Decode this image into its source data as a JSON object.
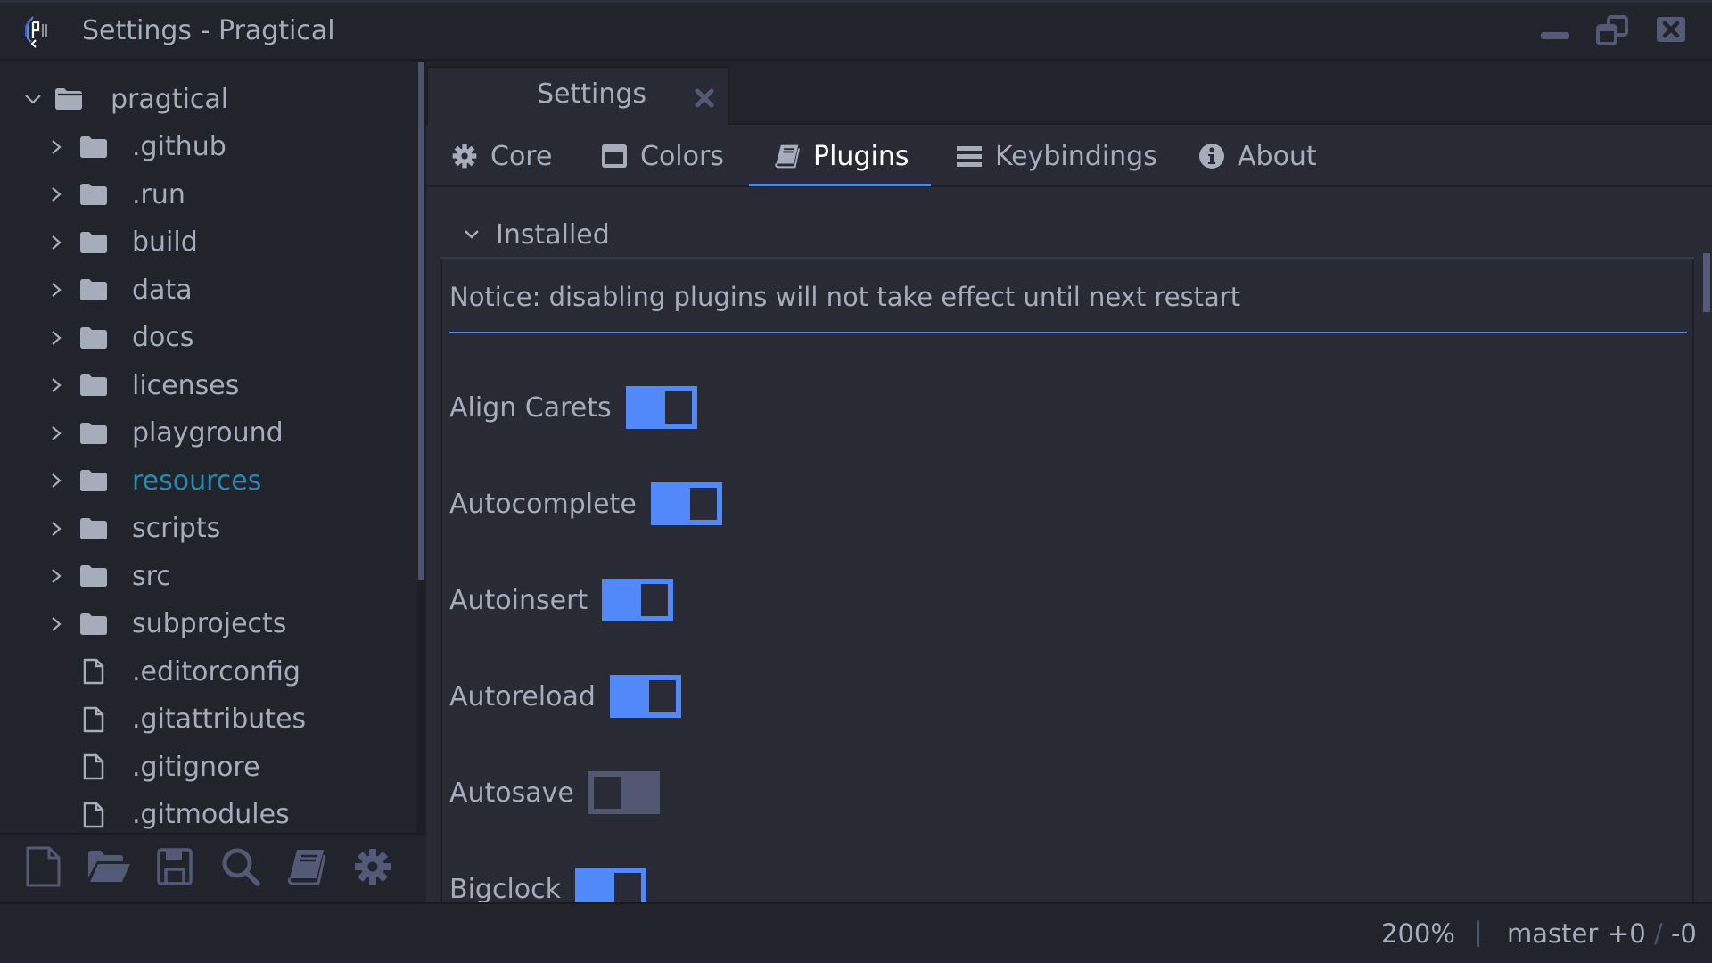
{
  "window": {
    "title": "Settings - Pragtical",
    "controls": [
      "minimize",
      "restore",
      "close"
    ]
  },
  "colors": {
    "accent": "#4f86f0",
    "toggle_on": "#5189fb",
    "toggle_off": "#525871",
    "highlight_folder": "#268bb3",
    "text": "#a5acba",
    "background": "#21242b",
    "panel": "#282b34"
  },
  "sidebar": {
    "tree": [
      {
        "label": "pragtical",
        "type": "folder",
        "expanded": true,
        "depth": 0,
        "icon": "folder-open-icon"
      },
      {
        "label": ".github",
        "type": "folder",
        "expanded": false,
        "depth": 1,
        "icon": "folder-icon"
      },
      {
        "label": ".run",
        "type": "folder",
        "expanded": false,
        "depth": 1,
        "icon": "folder-icon"
      },
      {
        "label": "build",
        "type": "folder",
        "expanded": false,
        "depth": 1,
        "icon": "folder-icon"
      },
      {
        "label": "data",
        "type": "folder",
        "expanded": false,
        "depth": 1,
        "icon": "folder-icon"
      },
      {
        "label": "docs",
        "type": "folder",
        "expanded": false,
        "depth": 1,
        "icon": "folder-icon"
      },
      {
        "label": "licenses",
        "type": "folder",
        "expanded": false,
        "depth": 1,
        "icon": "folder-icon"
      },
      {
        "label": "playground",
        "type": "folder",
        "expanded": false,
        "depth": 1,
        "icon": "folder-icon"
      },
      {
        "label": "resources",
        "type": "folder",
        "expanded": false,
        "depth": 1,
        "icon": "folder-icon",
        "highlighted": true
      },
      {
        "label": "scripts",
        "type": "folder",
        "expanded": false,
        "depth": 1,
        "icon": "folder-icon"
      },
      {
        "label": "src",
        "type": "folder",
        "expanded": false,
        "depth": 1,
        "icon": "folder-icon"
      },
      {
        "label": "subprojects",
        "type": "folder",
        "expanded": false,
        "depth": 1,
        "icon": "folder-icon"
      },
      {
        "label": ".editorconfig",
        "type": "file",
        "depth": 1,
        "icon": "file-icon"
      },
      {
        "label": ".gitattributes",
        "type": "file",
        "depth": 1,
        "icon": "file-icon"
      },
      {
        "label": ".gitignore",
        "type": "file",
        "depth": 1,
        "icon": "file-icon"
      },
      {
        "label": ".gitmodules",
        "type": "file",
        "depth": 1,
        "icon": "file-icon"
      }
    ],
    "toolbar": [
      {
        "name": "new-file",
        "icon": "new-file-icon"
      },
      {
        "name": "open-folder",
        "icon": "folder-open-icon"
      },
      {
        "name": "save",
        "icon": "save-icon"
      },
      {
        "name": "search",
        "icon": "search-icon"
      },
      {
        "name": "docs",
        "icon": "book-icon"
      },
      {
        "name": "settings",
        "icon": "gear-icon"
      }
    ]
  },
  "tabs": [
    {
      "label": "Settings",
      "active": true
    }
  ],
  "settings": {
    "nav": [
      {
        "label": "Core",
        "icon": "gear-icon",
        "active": false
      },
      {
        "label": "Colors",
        "icon": "window-icon",
        "active": false
      },
      {
        "label": "Plugins",
        "icon": "book-icon",
        "active": true
      },
      {
        "label": "Keybindings",
        "icon": "list-icon",
        "active": false
      },
      {
        "label": "About",
        "icon": "info-icon",
        "active": false
      }
    ],
    "section": {
      "title": "Installed",
      "expanded": true,
      "notice": "Notice: disabling plugins will not take effect until next restart"
    },
    "plugins": [
      {
        "label": "Align Carets",
        "enabled": true
      },
      {
        "label": "Autocomplete",
        "enabled": true
      },
      {
        "label": "Autoinsert",
        "enabled": true
      },
      {
        "label": "Autoreload",
        "enabled": true
      },
      {
        "label": "Autosave",
        "enabled": false
      },
      {
        "label": "Bigclock",
        "enabled": true
      }
    ]
  },
  "statusbar": {
    "zoom": "200%",
    "separator": "|",
    "branch": "master",
    "additions": "+0",
    "diff_separator": "/",
    "deletions": "-0"
  }
}
